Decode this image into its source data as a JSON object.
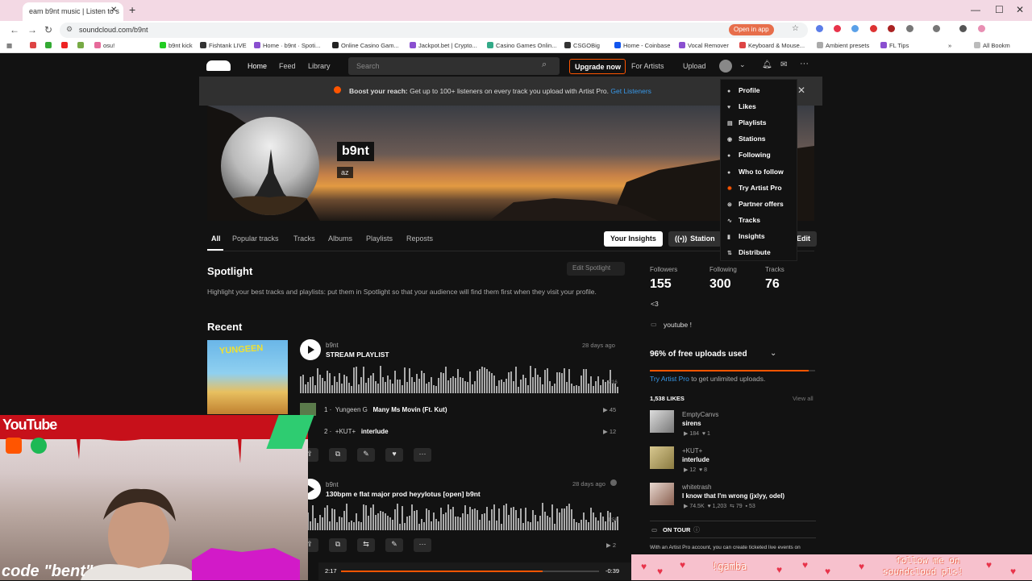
{
  "browser": {
    "tab_title": "eam b9nt music | Listen to s",
    "url": "soundcloud.com/b9nt",
    "open_in_app": "Open in app",
    "all_bookmarks": "All Bookm",
    "bookmarks": [
      "osu!",
      "b9nt kick",
      "Fishtank LIVE",
      "Home · b9nt · Spoti...",
      "Online Casino Gam...",
      "Jackpot.bet | Crypto...",
      "Casino Games Onlin...",
      "CSGOBig",
      "Home - Coinbase",
      "Vocal Remover",
      "Keyboard & Mouse...",
      "Ambient presets",
      "FL Tips"
    ]
  },
  "nav": {
    "home": "Home",
    "feed": "Feed",
    "library": "Library",
    "search_placeholder": "Search",
    "upgrade": "Upgrade now",
    "for_artists": "For Artists",
    "upload": "Upload"
  },
  "banner": {
    "bold": "Boost your reach:",
    "text": "Get up to 100+ listeners on every track you upload with Artist Pro.",
    "link": "Get Listeners"
  },
  "profile": {
    "name": "b9nt",
    "tagline": "az"
  },
  "tabs": [
    "All",
    "Popular tracks",
    "Tracks",
    "Albums",
    "Playlists",
    "Reposts"
  ],
  "buttons": {
    "insights": "Your Insights",
    "station": "Station",
    "edit": "Edit"
  },
  "spotlight": {
    "heading": "Spotlight",
    "edit": "Edit Spotlight",
    "desc": "Highlight your best tracks and playlists: put them in Spotlight so that your audience will find them first when they visit your profile."
  },
  "recent": {
    "heading": "Recent",
    "items": [
      {
        "artist": "b9nt",
        "title": "STREAM PLAYLIST",
        "ago": "28 days ago",
        "duration": "2:16",
        "tracks": [
          {
            "n": "1",
            "artist": "Yungeen G",
            "title": "Many Ms Movin (Ft. Kut)",
            "plays": "45"
          },
          {
            "n": "2",
            "artist": "+KUT+",
            "title": "interlude",
            "plays": "12"
          }
        ]
      },
      {
        "artist": "b9nt",
        "title": "130bpm e flat major prod heyylotus [open] b9nt",
        "ago": "28 days ago",
        "duration": "1:58",
        "plays": "2"
      }
    ]
  },
  "stats": {
    "followers_label": "Followers",
    "followers": "155",
    "following_label": "Following",
    "following": "300",
    "tracks_label": "Tracks",
    "tracks": "76"
  },
  "bio": "<3",
  "link": "youtube !",
  "uploads": {
    "label": "96% of free uploads used",
    "percent": 96,
    "cta_link": "Try Artist Pro",
    "cta_text": "to get unlimited uploads."
  },
  "likes": {
    "heading": "1,538 LIKES",
    "view_all": "View all",
    "items": [
      {
        "user": "EmptyCanvs",
        "title": "sirens",
        "plays": "184",
        "likes": "1",
        "reposts": "",
        "comments": ""
      },
      {
        "user": "+KUT+",
        "title": "interlude",
        "plays": "12",
        "likes": "8",
        "reposts": "",
        "comments": ""
      },
      {
        "user": "whitetrash",
        "title": "I know that I'm wrong (jxlyy, odel)",
        "plays": "74.5K",
        "likes": "1,203",
        "reposts": "79",
        "comments": "53"
      }
    ]
  },
  "on_tour": {
    "label": "ON TOUR",
    "text": "With an Artist Pro account, you can create ticketed live events on"
  },
  "dropdown": [
    {
      "icon": "person-icon",
      "label": "Profile"
    },
    {
      "icon": "heart-icon",
      "label": "Likes"
    },
    {
      "icon": "playlist-icon",
      "label": "Playlists"
    },
    {
      "icon": "station-icon",
      "label": "Stations"
    },
    {
      "icon": "following-icon",
      "label": "Following"
    },
    {
      "icon": "who-to-follow-icon",
      "label": "Who to follow"
    },
    {
      "icon": "artist-pro-icon",
      "label": "Try Artist Pro"
    },
    {
      "icon": "partner-icon",
      "label": "Partner offers"
    },
    {
      "icon": "waveform-icon",
      "label": "Tracks"
    },
    {
      "icon": "insights-icon",
      "label": "Insights"
    },
    {
      "icon": "distribute-icon",
      "label": "Distribute"
    }
  ],
  "player": {
    "elapsed": "2:17",
    "remaining": "-0:39",
    "progress": 0.78
  },
  "overlay": {
    "youtube": "YouTube",
    "code": "code \"bent\"",
    "gamba": "!gamba",
    "follow_line1": "follow me on",
    "follow_line2": "soundcloud pls!"
  },
  "colors": {
    "accent": "#ff5500",
    "bg": "#121212",
    "link": "#3898e8"
  }
}
